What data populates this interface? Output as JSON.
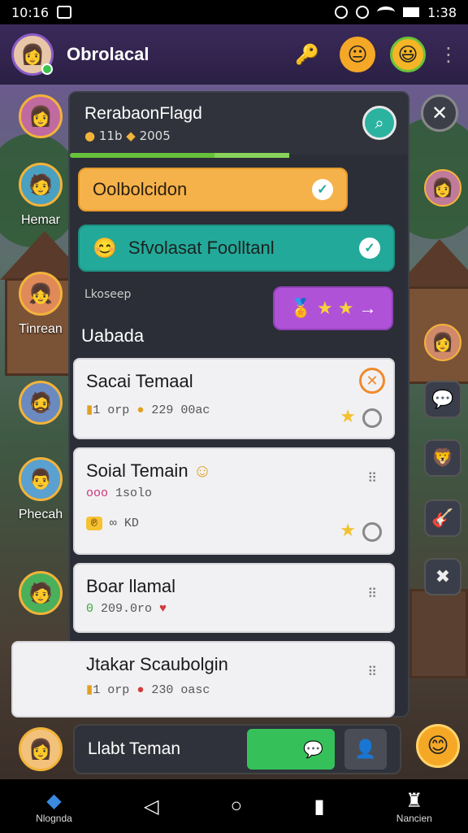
{
  "status": {
    "time": "10:16",
    "right_time": "1:38"
  },
  "app": {
    "title": "Obrolacal"
  },
  "panel": {
    "title": "RerabaonFlagd",
    "stats": "11b",
    "stats2": "2005",
    "search_icon": "search-icon"
  },
  "pills": {
    "orange": "Oolbolcidon",
    "teal": "Sfvolasat Foolltanl",
    "purple_arrow": "→"
  },
  "hidden_label": "Lkoseep",
  "section_title": "Uabada",
  "left_names": [
    "Hemar",
    "Tinrean",
    "Phecah"
  ],
  "cards": [
    {
      "name": "Sacai Temaal",
      "meta_a": "1",
      "meta_b": "orp",
      "meta_c": "229 00ac"
    },
    {
      "name": "Soial  Temain",
      "meta_a": "ooo",
      "meta_b": "1solo",
      "chip": "℗",
      "meta_c": "KD"
    },
    {
      "name": "Boar llamal",
      "meta_a": "0",
      "meta_b": "209.0ro"
    },
    {
      "name": "Jtakar Scaubolgin",
      "meta_a": "1",
      "meta_b": "orp",
      "meta_c": "230 oasc"
    }
  ],
  "input": {
    "placeholder": "Llabt Teman"
  },
  "nav": {
    "left_label": "Nlognda",
    "right_label": "Nancien"
  },
  "colors": {
    "accent_purple": "#b052d8",
    "teal": "#23a99a",
    "orange": "#f6b24a",
    "green": "#36c05a"
  }
}
